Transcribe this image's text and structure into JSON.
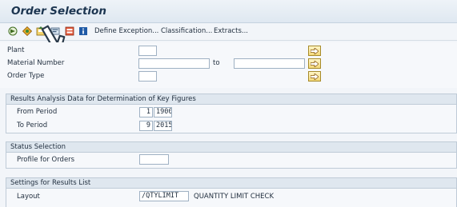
{
  "header": {
    "title": "Order Selection"
  },
  "toolbar": {
    "icons": [
      "execute-icon",
      "get-variant-icon",
      "save-variant-icon",
      "program-documentation-icon",
      "layout-icon",
      "info-icon"
    ],
    "define_exception": "Define Exception...",
    "classification": "Classification...",
    "extracts": "Extracts..."
  },
  "selection": {
    "plant_label": "Plant",
    "plant_value": "",
    "material_label": "Material Number",
    "material_from": "",
    "to_label": "to",
    "material_to": "",
    "order_type_label": "Order Type",
    "order_type_value": ""
  },
  "results_analysis": {
    "title": "Results Analysis Data for Determination of Key Figures",
    "from_period_label": "From Period",
    "from_period": "1",
    "from_year": "1900",
    "to_period_label": "To Period",
    "to_period": "9",
    "to_year": "2015"
  },
  "status_selection": {
    "title": "Status Selection",
    "profile_label": "Profile for Orders",
    "profile_value": ""
  },
  "settings": {
    "title": "Settings for Results List",
    "layout_label": "Layout",
    "layout_value": "/QTYLIMIT",
    "layout_description": "QUANTITY LIMIT CHECK"
  },
  "colors": {
    "accent": "#1c3550",
    "multiselect_fill": "#f4d97a",
    "header_fill": "#dfe7ef"
  }
}
